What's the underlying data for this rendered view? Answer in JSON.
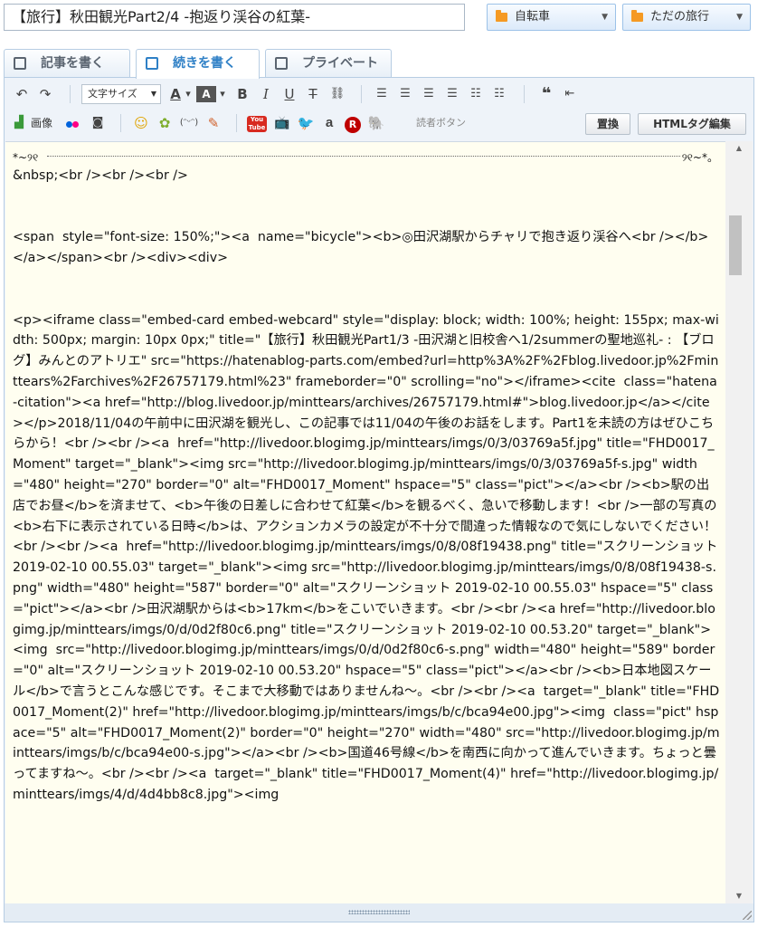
{
  "post": {
    "title": "【旅行】秋田観光Part2/4 -抱返り渓谷の紅葉-"
  },
  "categories": [
    {
      "label": "自転車",
      "folder_color": "#f59a23"
    },
    {
      "label": "ただの旅行",
      "folder_color": "#f59a23"
    }
  ],
  "tabs": [
    {
      "label": "記事を書く",
      "active": false
    },
    {
      "label": "続きを書く",
      "active": true
    },
    {
      "label": "プライベート",
      "active": false
    }
  ],
  "toolbar": {
    "font_size_label": "文字サイズ",
    "reader_button_label": "読者ボタン",
    "replace_button_label": "置換",
    "html_edit_button_label": "HTMLタグ編集",
    "image_button_label": "画像",
    "bold_glyph": "B",
    "italic_glyph": "I",
    "underline_glyph": "U",
    "strike_glyph": "T",
    "font_color_glyph": "A",
    "bg_color_glyph": "A",
    "amazon_glyph": "a",
    "rakuten_glyph": "R",
    "youtube_label": "You Tube"
  },
  "code_lines": [
    "&nbsp;<br /><br /><br />",
    "",
    "",
    "<span  style=\"font-size: 150%;\"><a  name=\"bicycle\"><b>◎田沢湖駅からチャリで抱き返り渓谷へ<br /></b></a></span><br /><div><div>",
    "",
    "",
    "<p><iframe class=\"embed-card embed-webcard\" style=\"display: block; width: 100%; height: 155px; max-width: 500px; margin: 10px 0px;\" title=\"【旅行】秋田観光Part1/3 -田沢湖と旧校舎へ1/2summerの聖地巡礼- : 【ブログ】みんとのアトリエ\" src=\"https://hatenablog-parts.com/embed?url=http%3A%2F%2Fblog.livedoor.jp%2Fminttears%2Farchives%2F26757179.html%23\" frameborder=\"0\" scrolling=\"no\"></iframe><cite  class=\"hatena-citation\"><a href=\"http://blog.livedoor.jp/minttears/archives/26757179.html#\">blog.livedoor.jp</a></cite></p>2018/11/04の午前中に田沢湖を観光し、この記事では11/04の午後のお話をします。Part1を未読の方はぜひこちらから！<br /><br /><a  href=\"http://livedoor.blogimg.jp/minttears/imgs/0/3/03769a5f.jpg\" title=\"FHD0017_Moment\" target=\"_blank\"><img src=\"http://livedoor.blogimg.jp/minttears/imgs/0/3/03769a5f-s.jpg\" width=\"480\" height=\"270\" border=\"0\" alt=\"FHD0017_Moment\" hspace=\"5\" class=\"pict\"></a><br /><b>駅の出店でお昼</b>を済ませて、<b>午後の日差しに合わせて紅葉</b>を観るべく、急いで移動します！<br />一部の写真の<b>右下に表示されている日時</b>は、アクションカメラの設定が不十分で間違った情報なので気にしないでください！<br /><br /><a  href=\"http://livedoor.blogimg.jp/minttears/imgs/0/8/08f19438.png\" title=\"スクリーンショット 2019-02-10 00.55.03\" target=\"_blank\"><img src=\"http://livedoor.blogimg.jp/minttears/imgs/0/8/08f19438-s.png\" width=\"480\" height=\"587\" border=\"0\" alt=\"スクリーンショット 2019-02-10 00.55.03\" hspace=\"5\" class=\"pict\"></a><br />田沢湖駅からは<b>17km</b>をこいでいきます。<br /><br /><a href=\"http://livedoor.blogimg.jp/minttears/imgs/0/d/0d2f80c6.png\" title=\"スクリーンショット 2019-02-10 00.53.20\" target=\"_blank\"><img  src=\"http://livedoor.blogimg.jp/minttears/imgs/0/d/0d2f80c6-s.png\" width=\"480\" height=\"589\" border=\"0\" alt=\"スクリーンショット 2019-02-10 00.53.20\" hspace=\"5\" class=\"pict\"></a><br /><b>日本地図スケール</b>で言うとこんな感じです。そこまで大移動ではありませんね〜。<br /><br /><a  target=\"_blank\" title=\"FHD0017_Moment(2)\" href=\"http://livedoor.blogimg.jp/minttears/imgs/b/c/bca94e00.jpg\"><img  class=\"pict\" hspace=\"5\" alt=\"FHD0017_Moment(2)\" border=\"0\" height=\"270\" width=\"480\" src=\"http://livedoor.blogimg.jp/minttears/imgs/b/c/bca94e00-s.jpg\"></a><br /><b>国道46号線</b>を南西に向かって進んでいきます。ちょっと曇ってますね〜。<br /><br /><a  target=\"_blank\" title=\"FHD0017_Moment(4)\" href=\"http://livedoor.blogimg.jp/minttears/imgs/4/d/4d4bb8c8.jpg\"><img"
  ],
  "deco_left": "*~୨୧",
  "deco_right": "୨୧~*。"
}
